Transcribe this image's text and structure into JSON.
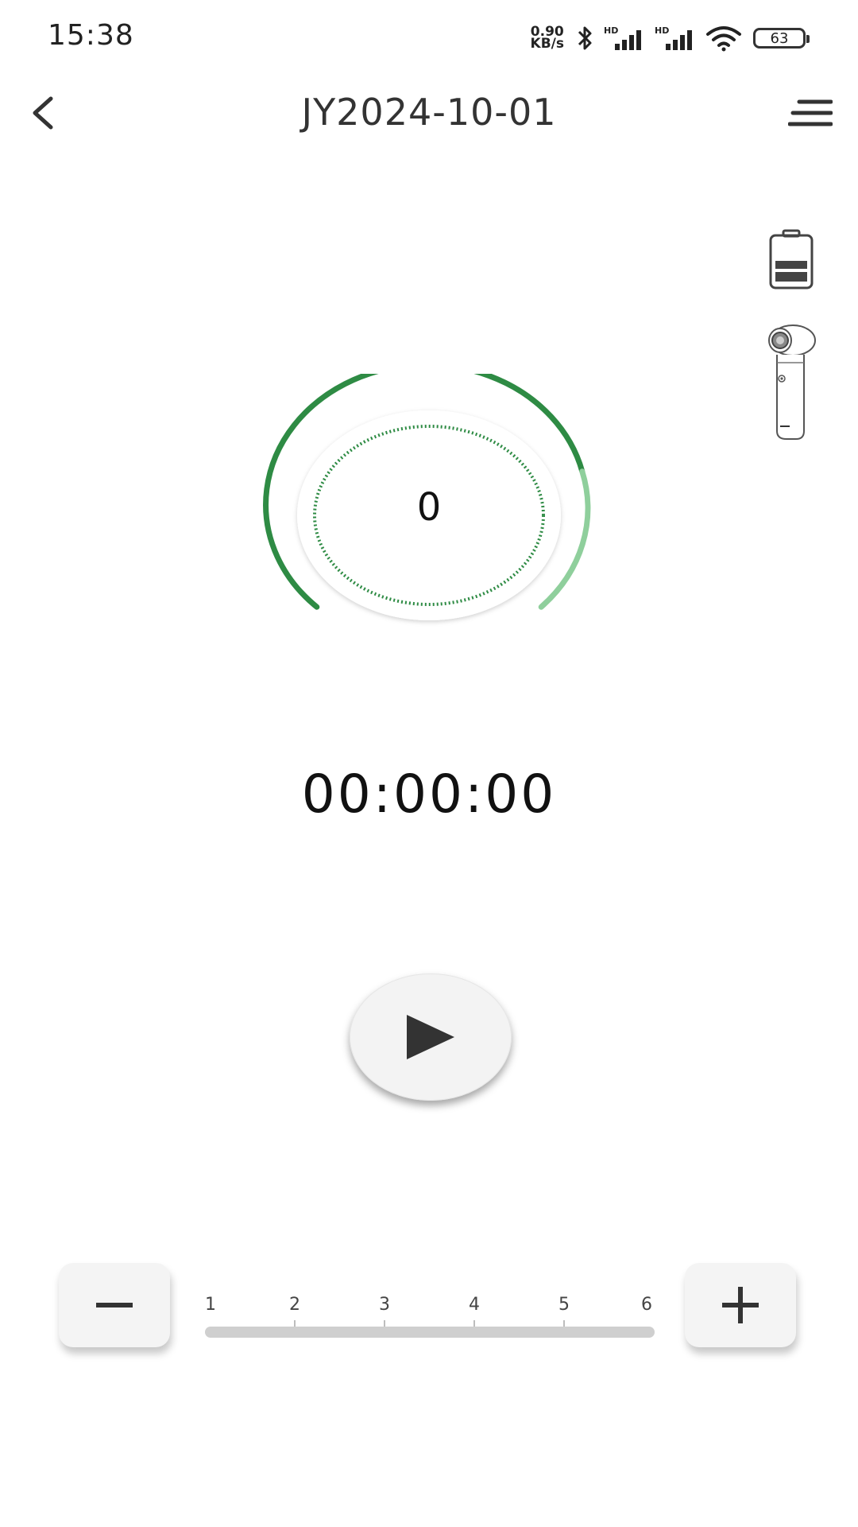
{
  "status_bar": {
    "time": "15:38",
    "net_speed_value": "0.90",
    "net_speed_unit": "KB/s",
    "hd_label_1": "HD",
    "hd_label_2": "HD",
    "battery_level": "63",
    "icons": [
      "bluetooth-icon",
      "signal-hd-icon",
      "signal-hd-icon",
      "wifi-icon",
      "battery-icon"
    ]
  },
  "header": {
    "title": "JY2024-10-01",
    "back_icon": "chevron-left-icon",
    "menu_icon": "hamburger-menu-icon"
  },
  "side_panel": {
    "battery_icon": "device-battery-icon",
    "battery_fill_bars_shown": 2,
    "device_icon": "massage-gun-device-icon"
  },
  "dial": {
    "value": "0",
    "accent_color": "#2e8b44",
    "accent_light_color": "#8fcf9c"
  },
  "timer": {
    "display": "00:00:00"
  },
  "controls": {
    "play_icon": "play-icon",
    "minus_icon": "minus-icon",
    "plus_icon": "plus-icon"
  },
  "level_scale": {
    "labels": [
      "1",
      "2",
      "3",
      "4",
      "5",
      "6"
    ],
    "track_color": "#cfcfcf"
  }
}
